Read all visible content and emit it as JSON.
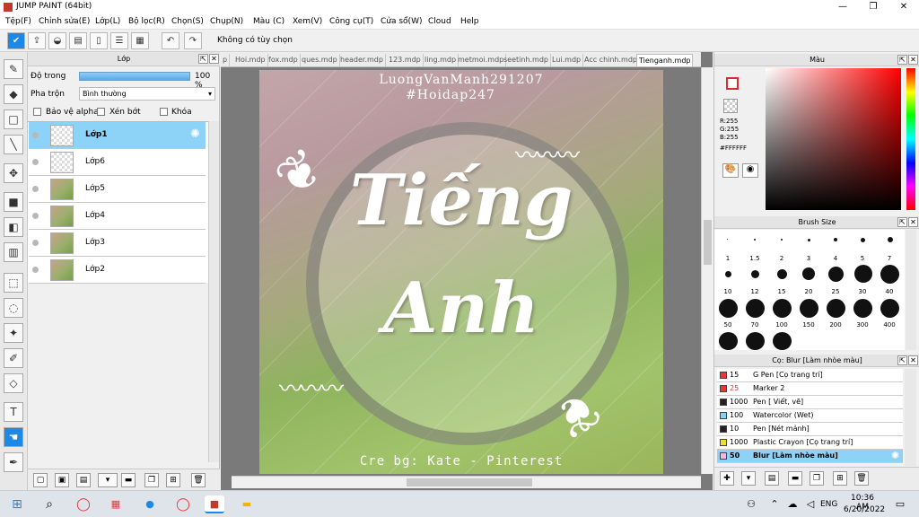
{
  "window": {
    "title": "JUMP PAINT (64bit)",
    "min": "—",
    "max": "❐",
    "close": "✕"
  },
  "menu": [
    "Tệp(F)",
    "Chỉnh sửa(E)",
    "Lớp(L)",
    "Bộ lọc(R)",
    "Chọn(S)",
    "Chụp(N)",
    "Màu (C)",
    "Xem(V)",
    "Công cụ(T)",
    "Cửa sổ(W)",
    "Cloud",
    "Help"
  ],
  "toolbar": {
    "hint": "Không có tùy chọn"
  },
  "layer_panel": {
    "title": "Lớp",
    "opacity_label": "Độ trong",
    "opacity_value": "100 %",
    "opacity_fraction": 1.0,
    "blend_label": "Pha trộn",
    "blend_value": "Bình thường",
    "protect_alpha": "Bảo vệ alpha",
    "clipping": "Xén bớt",
    "lock": "Khóa",
    "layers": [
      {
        "name": "Lớp1",
        "selected": true,
        "thumb": "blank"
      },
      {
        "name": "Lớp6",
        "selected": false,
        "thumb": "blank"
      },
      {
        "name": "Lớp5",
        "selected": false,
        "thumb": "img"
      },
      {
        "name": "Lớp4",
        "selected": false,
        "thumb": "img"
      },
      {
        "name": "Lớp3",
        "selected": false,
        "thumb": "img"
      },
      {
        "name": "Lớp2",
        "selected": false,
        "thumb": "img"
      }
    ]
  },
  "doc_tabs": [
    "p",
    "Hoi.mdp",
    "fox.mdp",
    "ques.mdp",
    "header.mdp",
    "123.mdp",
    "ling.mdp",
    "metmoi.mdp",
    "seetinh.mdp",
    "Lui.mdp",
    "Acc chinh.mdp",
    "Tienganh.mdp"
  ],
  "artwork": {
    "credit_name": "LuongVanManh291207",
    "hashtag": "#Hoidap247",
    "title_line1": "Tiếng",
    "title_line2": "Anh",
    "credit_bg": "Cre bg: Kate - Pinterest"
  },
  "color_panel": {
    "title": "Màu",
    "r": "R:255",
    "g": "G:255",
    "b": "B:255",
    "hex": "#FFFFFF"
  },
  "brush_size": {
    "title": "Brush Size",
    "sizes": [
      "1",
      "1.5",
      "2",
      "3",
      "4",
      "5",
      "7",
      "10",
      "12",
      "15",
      "20",
      "25",
      "30",
      "40",
      "50",
      "70",
      "100",
      "150",
      "200",
      "300",
      "400"
    ]
  },
  "brush_panel": {
    "title": "Cọ: Blur [Làm nhòe màu]",
    "brushes": [
      {
        "size": "15",
        "name": "G Pen [Cọ trang trí]",
        "color": "#e53935"
      },
      {
        "size": "25",
        "name": "Marker 2",
        "color": "#e53935"
      },
      {
        "size": "1000",
        "name": "Pen [ Viết, vẽ]",
        "color": "#222222"
      },
      {
        "size": "100",
        "name": "Watercolor (Wet)",
        "color": "#7fd3f7"
      },
      {
        "size": "10",
        "name": "Pen [Nét mảnh]",
        "color": "#222222"
      },
      {
        "size": "1000",
        "name": "Plastic Crayon [Cọ trang trí]",
        "color": "#f0e020"
      },
      {
        "size": "50",
        "name": "Blur [Làm nhòe màu]",
        "color": "#f4b8e4",
        "selected": true
      }
    ]
  },
  "taskbar": {
    "time": "10:36 AM",
    "date": "6/20/2022",
    "lang": "ENG"
  },
  "colors": {
    "accent": "#1e88e5",
    "selection": "#8dd3f8"
  }
}
